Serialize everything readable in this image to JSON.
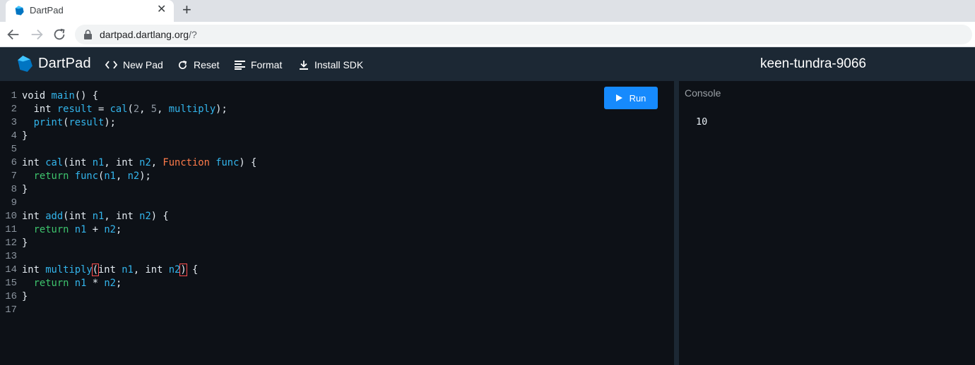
{
  "browser": {
    "tab_title": "DartPad",
    "tab_close": "✕",
    "new_tab": "+",
    "url_host": "dartpad.dartlang.org",
    "url_path": "/?"
  },
  "toolbar": {
    "brand": "DartPad",
    "new_pad": "New Pad",
    "reset": "Reset",
    "format": "Format",
    "install_sdk": "Install SDK",
    "pad_name": "keen-tundra-9066",
    "run": "Run"
  },
  "editor": {
    "line_numbers": [
      "1",
      "2",
      "3",
      "4",
      "5",
      "6",
      "7",
      "8",
      "9",
      "10",
      "11",
      "12",
      "13",
      "14",
      "15",
      "16",
      "17"
    ],
    "lines": [
      [
        {
          "t": "void ",
          "c": ""
        },
        {
          "t": "main",
          "c": "fn"
        },
        {
          "t": "() {",
          "c": ""
        }
      ],
      [
        {
          "t": "  int ",
          "c": ""
        },
        {
          "t": "result",
          "c": "fn"
        },
        {
          "t": " = ",
          "c": ""
        },
        {
          "t": "cal",
          "c": "fn"
        },
        {
          "t": "(",
          "c": ""
        },
        {
          "t": "2",
          "c": "num"
        },
        {
          "t": ", ",
          "c": ""
        },
        {
          "t": "5",
          "c": "num"
        },
        {
          "t": ", ",
          "c": ""
        },
        {
          "t": "multiply",
          "c": "fn"
        },
        {
          "t": ");",
          "c": ""
        }
      ],
      [
        {
          "t": "  ",
          "c": ""
        },
        {
          "t": "print",
          "c": "fn"
        },
        {
          "t": "(",
          "c": ""
        },
        {
          "t": "result",
          "c": "fn"
        },
        {
          "t": ");",
          "c": ""
        }
      ],
      [
        {
          "t": "}",
          "c": ""
        }
      ],
      [],
      [
        {
          "t": "int ",
          "c": ""
        },
        {
          "t": "cal",
          "c": "fn"
        },
        {
          "t": "(int ",
          "c": ""
        },
        {
          "t": "n1",
          "c": "fn"
        },
        {
          "t": ", int ",
          "c": ""
        },
        {
          "t": "n2",
          "c": "fn"
        },
        {
          "t": ", ",
          "c": ""
        },
        {
          "t": "Function",
          "c": "ty"
        },
        {
          "t": " ",
          "c": ""
        },
        {
          "t": "func",
          "c": "fn"
        },
        {
          "t": ") {",
          "c": ""
        }
      ],
      [
        {
          "t": "  ",
          "c": ""
        },
        {
          "t": "return",
          "c": "kw"
        },
        {
          "t": " ",
          "c": ""
        },
        {
          "t": "func",
          "c": "fn"
        },
        {
          "t": "(",
          "c": ""
        },
        {
          "t": "n1",
          "c": "fn"
        },
        {
          "t": ", ",
          "c": ""
        },
        {
          "t": "n2",
          "c": "fn"
        },
        {
          "t": ");",
          "c": ""
        }
      ],
      [
        {
          "t": "}",
          "c": ""
        }
      ],
      [],
      [
        {
          "t": "int ",
          "c": ""
        },
        {
          "t": "add",
          "c": "fn"
        },
        {
          "t": "(int ",
          "c": ""
        },
        {
          "t": "n1",
          "c": "fn"
        },
        {
          "t": ", int ",
          "c": ""
        },
        {
          "t": "n2",
          "c": "fn"
        },
        {
          "t": ") {",
          "c": ""
        }
      ],
      [
        {
          "t": "  ",
          "c": ""
        },
        {
          "t": "return",
          "c": "kw"
        },
        {
          "t": " ",
          "c": ""
        },
        {
          "t": "n1",
          "c": "fn"
        },
        {
          "t": " + ",
          "c": ""
        },
        {
          "t": "n2",
          "c": "fn"
        },
        {
          "t": ";",
          "c": ""
        }
      ],
      [
        {
          "t": "}",
          "c": ""
        }
      ],
      [],
      [
        {
          "t": "int ",
          "c": ""
        },
        {
          "t": "multiply",
          "c": "fn"
        },
        {
          "t": "(",
          "c": "bm"
        },
        {
          "t": "int ",
          "c": ""
        },
        {
          "t": "n1",
          "c": "fn"
        },
        {
          "t": ", int ",
          "c": ""
        },
        {
          "t": "n2",
          "c": "fn"
        },
        {
          "t": ")",
          "c": "bm"
        },
        {
          "t": " {",
          "c": ""
        }
      ],
      [
        {
          "t": "  ",
          "c": ""
        },
        {
          "t": "return",
          "c": "kw"
        },
        {
          "t": " ",
          "c": ""
        },
        {
          "t": "n1",
          "c": "fn"
        },
        {
          "t": " * ",
          "c": ""
        },
        {
          "t": "n2",
          "c": "fn"
        },
        {
          "t": ";",
          "c": ""
        }
      ],
      [
        {
          "t": "}",
          "c": ""
        }
      ],
      []
    ]
  },
  "console": {
    "title": "Console",
    "output": "10"
  },
  "colors": {
    "header_bg": "#1c2834",
    "editor_bg": "#0d1117",
    "run_button": "#168afd",
    "identifier": "#33b5ec",
    "keyword": "#3ec46d",
    "type": "#ff7b4a"
  },
  "icons": {
    "tab_favicon": "dart-logo-icon",
    "back": "arrow-left-icon",
    "forward": "arrow-right-icon",
    "reload": "reload-icon",
    "lock": "lock-icon",
    "new_pad": "code-brackets-icon",
    "reset": "refresh-icon",
    "format": "format-lines-icon",
    "install_sdk": "download-icon",
    "run": "play-icon"
  }
}
